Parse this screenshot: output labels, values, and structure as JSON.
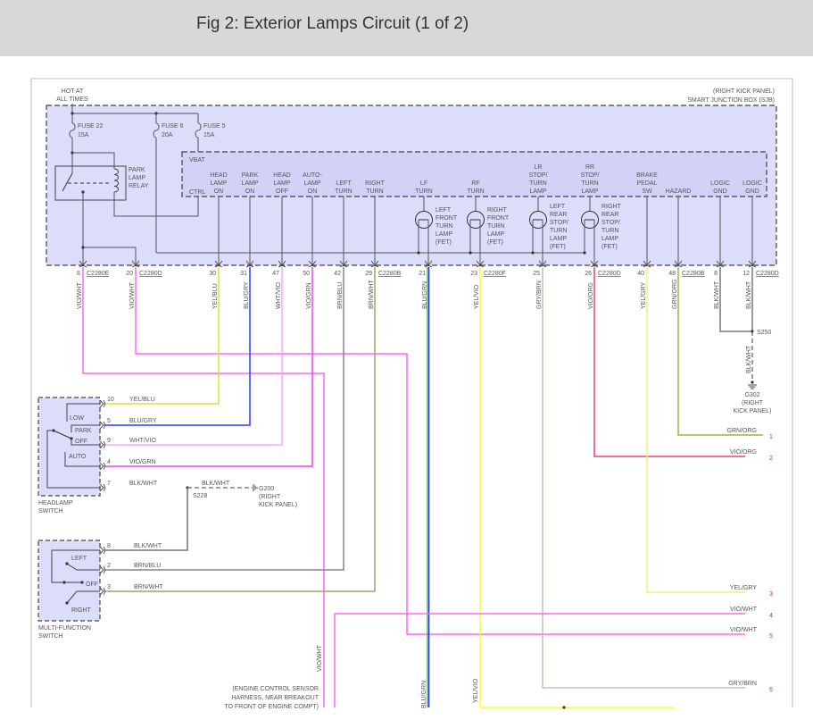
{
  "header": {
    "title": "Fig 2: Exterior Lamps Circuit (1 of 2)"
  },
  "power": {
    "hot_label": [
      "HOT AT",
      "ALL TIMES"
    ]
  },
  "sjb": {
    "location": "(RIGHT KICK PANEL)",
    "name": "SMART JUNCTION BOX (SJB)",
    "vbat": "VBAT",
    "ctrl": "CTRL",
    "relay": [
      "PARK",
      "LAMP",
      "RELAY"
    ],
    "fuses": [
      {
        "name": "FUSE 22",
        "rating": "15A"
      },
      {
        "name": "FUSE 6",
        "rating": "20A"
      },
      {
        "name": "FUSE 5",
        "rating": "15A"
      }
    ],
    "outputs": [
      {
        "lines": [
          "HEAD",
          "LAMP",
          "ON"
        ]
      },
      {
        "lines": [
          "PARK",
          "LAMP",
          "ON"
        ]
      },
      {
        "lines": [
          "HEAD",
          "LAMP",
          "OFF"
        ]
      },
      {
        "lines": [
          "AUTO-",
          "LAMP",
          "ON"
        ]
      },
      {
        "lines": [
          "LEFT",
          "TURN"
        ]
      },
      {
        "lines": [
          "RIGHT",
          "TURN"
        ]
      },
      {
        "lines": [
          "LF",
          "TURN"
        ]
      },
      {
        "lines": [
          "RF",
          "TURN"
        ]
      },
      {
        "lines": [
          "LR",
          "STOP/",
          "TURN",
          "LAMP"
        ]
      },
      {
        "lines": [
          "RR",
          "STOP/",
          "TURN",
          "LAMP"
        ]
      },
      {
        "lines": [
          "BRAKE",
          "PEDAL",
          "SW"
        ]
      },
      {
        "lines": [
          "HAZARD"
        ]
      },
      {
        "lines": [
          "LOGIC",
          "GND"
        ]
      },
      {
        "lines": [
          "LOGIC",
          "GND"
        ]
      }
    ],
    "lamps": [
      {
        "lines": [
          "LEFT",
          "FRONT",
          "TURN",
          "LAMP",
          "(FET)"
        ]
      },
      {
        "lines": [
          "RIGHT",
          "FRONT",
          "TURN",
          "LAMP",
          "(FET)"
        ]
      },
      {
        "lines": [
          "LEFT",
          "REAR",
          "STOP/",
          "TURN",
          "LAMP",
          "(FET)"
        ]
      },
      {
        "lines": [
          "RIGHT",
          "REAR",
          "STOP/",
          "TURN",
          "LAMP",
          "(FET)"
        ]
      }
    ]
  },
  "pins": [
    {
      "num": "6",
      "connector": "C2280E",
      "wire": "VIO/WHT",
      "color": "#ff66ff"
    },
    {
      "num": "20",
      "connector": "C2280D",
      "wire": "VIO/WHT",
      "color": "#ff66ff"
    },
    {
      "num": "30",
      "connector": "",
      "wire": "YEL/BLU",
      "color": "#e6dc3c"
    },
    {
      "num": "31",
      "connector": "",
      "wire": "BLU/GRY",
      "color": "#2b3bff"
    },
    {
      "num": "47",
      "connector": "",
      "wire": "WHT/VIO",
      "color": "#f5a8f5"
    },
    {
      "num": "50",
      "connector": "",
      "wire": "VIO/GRN",
      "color": "#ee44ee"
    },
    {
      "num": "42",
      "connector": "",
      "wire": "BRN/BLU",
      "color": "#8c8090"
    },
    {
      "num": "29",
      "connector": "C2280B",
      "wire": "BRN/WHT",
      "color": "#b09a6a"
    },
    {
      "num": "21",
      "connector": "",
      "wire": "BLU/GRN",
      "color": "#2233dd"
    },
    {
      "num": "23",
      "connector": "C2280F",
      "wire": "YEL/VIO",
      "color": "#ffff22"
    },
    {
      "num": "25",
      "connector": "",
      "wire": "GRY/BRN",
      "color": "#c8bfae"
    },
    {
      "num": "26",
      "connector": "C2280D",
      "wire": "VIO/ORG",
      "color": "#e8407a"
    },
    {
      "num": "40",
      "connector": "",
      "wire": "YEL/GRY",
      "color": "#f0f07a"
    },
    {
      "num": "48",
      "connector": "C2280B",
      "wire": "GRN/ORG",
      "color": "#8cbf3c"
    },
    {
      "num": "8",
      "connector": "",
      "wire": "BLK/WHT",
      "color": "#777777"
    },
    {
      "num": "12",
      "connector": "C2280D",
      "wire": "BLK/WHT",
      "color": "#777777"
    }
  ],
  "headlamp_switch": {
    "name": [
      "HEADLAMP",
      "SWITCH"
    ],
    "positions": [
      "LOW",
      "PARK",
      "OFF",
      "AUTO"
    ],
    "pins": [
      {
        "num": "10",
        "wire": "YEL/BLU"
      },
      {
        "num": "5",
        "wire": "BLU/GRY"
      },
      {
        "num": "9",
        "wire": "WHT/VIO"
      },
      {
        "num": "4",
        "wire": "VIO/GRN"
      },
      {
        "num": "7",
        "wire": "BLK/WHT"
      }
    ]
  },
  "splice_s228": {
    "name": "S228",
    "wire": "BLK/WHT"
  },
  "ground_g200": [
    "G200",
    "(RIGHT",
    "KICK PANEL)"
  ],
  "multifunction_switch": {
    "name": [
      "MULTI-FUNCTION",
      "SWITCH"
    ],
    "positions": [
      "LEFT",
      "OFF",
      "RIGHT"
    ],
    "pins": [
      {
        "num": "8",
        "wire": "BLK/WHT"
      },
      {
        "num": "2",
        "wire": "BRN/BLU"
      },
      {
        "num": "3",
        "wire": "BRN/WHT"
      }
    ]
  },
  "splice_s250": {
    "name": "S250",
    "wire": "BLK/WHT"
  },
  "ground_g302": [
    "G302",
    "(RIGHT",
    "KICK PANEL)"
  ],
  "outputs_right": [
    {
      "wire": "GRN/ORG",
      "num": "1"
    },
    {
      "wire": "VIO/ORG",
      "num": "2"
    },
    {
      "wire": "YEL/GRY",
      "num": "3"
    },
    {
      "wire": "VIO/WHT",
      "num": "4"
    },
    {
      "wire": "VIO/WHT",
      "num": "5"
    },
    {
      "wire": "GRY/BRN",
      "num": "6"
    }
  ],
  "bottom": {
    "note": [
      "(ENGINE CONTROL SENSOR",
      "HARNESS, NEAR BREAKOUT",
      "TO FRONT OF ENGINE COMPT)"
    ],
    "wires": [
      "VIO/WHT",
      "BLU/GRN",
      "YEL/VIO"
    ]
  },
  "colors": {
    "sjb_fill": "#dcdcfb",
    "inner_fill": "#d2d2f6",
    "line": "#555555",
    "header_bg": "#d8d8d8",
    "green_stripe": "#3a9a3a"
  }
}
